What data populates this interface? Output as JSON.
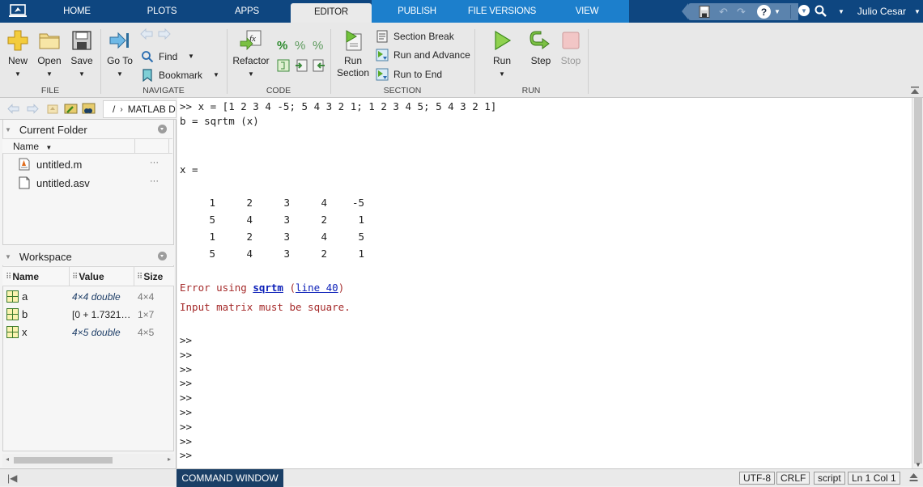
{
  "tabs": [
    {
      "label": "HOME",
      "active": false
    },
    {
      "label": "PLOTS",
      "active": false
    },
    {
      "label": "APPS",
      "active": false
    },
    {
      "label": "EDITOR",
      "active": true
    },
    {
      "label": "PUBLISH",
      "active": false
    },
    {
      "label": "FILE VERSIONS",
      "active": false
    },
    {
      "label": "VIEW",
      "active": false
    }
  ],
  "user": {
    "name": "Julio Cesar"
  },
  "ribbon": {
    "file": {
      "label": "FILE",
      "new": "New",
      "open": "Open",
      "save": "Save"
    },
    "navigate": {
      "label": "NAVIGATE",
      "goto": "Go To",
      "find": "Find",
      "bookmark": "Bookmark"
    },
    "code": {
      "label": "CODE",
      "refactor": "Refactor"
    },
    "section": {
      "label": "SECTION",
      "run_section_1": "Run",
      "run_section_2": "Section",
      "section_break": "Section Break",
      "run_and_advance": "Run and Advance",
      "run_to_end": "Run to End"
    },
    "run": {
      "label": "RUN",
      "run": "Run",
      "step": "Step",
      "stop": "Stop"
    }
  },
  "address": {
    "separator": "/",
    "path": "MATLAB Drive"
  },
  "current_folder": {
    "title": "Current Folder",
    "column": "Name",
    "files": [
      {
        "name": "untitled.m",
        "type": "m-file",
        "more": "···"
      },
      {
        "name": "untitled.asv",
        "type": "file",
        "more": "···"
      }
    ]
  },
  "workspace": {
    "title": "Workspace",
    "columns": [
      "Name",
      "Value",
      "Size"
    ],
    "variables": [
      {
        "name": "a",
        "value": "4×4 double",
        "size": "4×4",
        "italic": true
      },
      {
        "name": "b",
        "value": "[0 + 1.7321…",
        "size": "1×7",
        "italic": false
      },
      {
        "name": "x",
        "value": "4×5 double",
        "size": "4×5",
        "italic": true
      }
    ]
  },
  "command_window": {
    "input_line_1": ">> x = [1 2 3 4 -5; 5 4 3 2 1; 1 2 3 4 5; 5 4 3 2 1]",
    "input_line_2": "b = sqrtm (x)",
    "output_var": "x =",
    "matrix": [
      [
        1,
        2,
        3,
        4,
        -5
      ],
      [
        5,
        4,
        3,
        2,
        1
      ],
      [
        1,
        2,
        3,
        4,
        5
      ],
      [
        5,
        4,
        3,
        2,
        1
      ]
    ],
    "error_prefix": "Error using ",
    "error_func": "sqrtm",
    "error_open": " (",
    "error_line": "line 40",
    "error_close": ")",
    "error_message": "Input matrix must be square.",
    "prompts": [
      ">>",
      ">>",
      ">>",
      ">>",
      ">>",
      ">>",
      ">>",
      ">>",
      ">>"
    ]
  },
  "status_bar": {
    "panel_tab": "COMMAND WINDOW",
    "encoding": "UTF-8",
    "line_ending": "CRLF",
    "file_type": "script",
    "position": "Ln  1  Col  1"
  }
}
